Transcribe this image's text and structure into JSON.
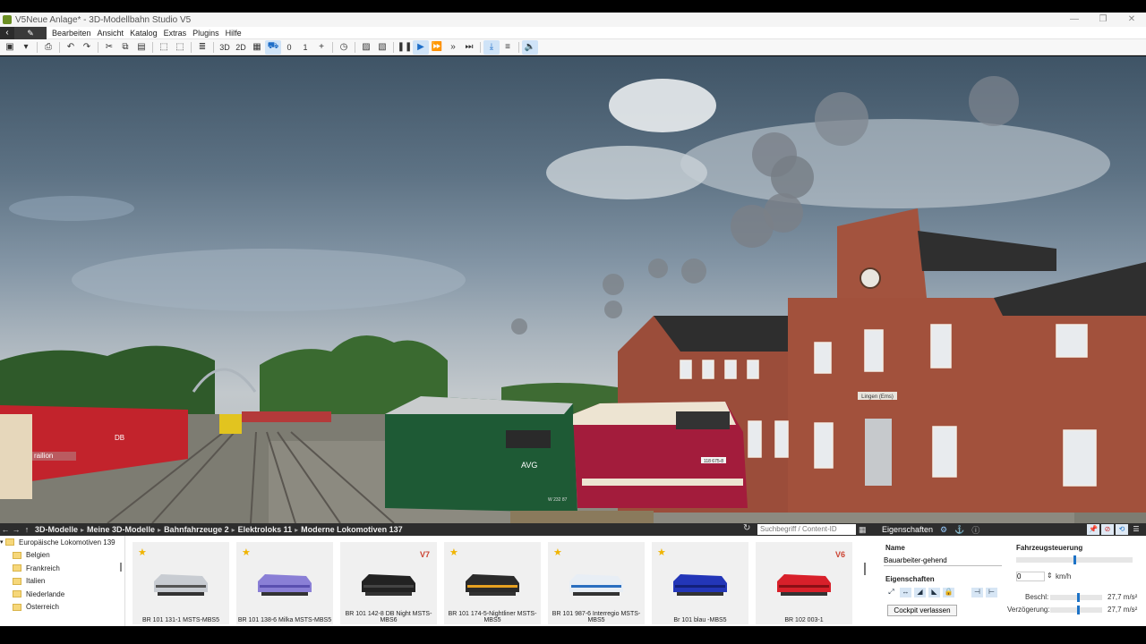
{
  "window": {
    "title": "V5Neue Anlage* - 3D-Modellbahn Studio V5",
    "controls": [
      "—",
      "❐",
      "✕"
    ]
  },
  "menubar": {
    "items": [
      "Bearbeiten",
      "Ansicht",
      "Katalog",
      "Extras",
      "Plugins",
      "Hilfe"
    ]
  },
  "toolbar": {
    "view_3d": "3D",
    "view_2d": "2D",
    "counter_a": "0",
    "counter_b": "1"
  },
  "scene": {
    "station_sign": "Lingen (Ems)",
    "loco_green_label": "AVG",
    "loco_right_number": "118 675-8",
    "loco_green_number": "W 232 87",
    "wagon_brand": "railion",
    "wagon_logo": "DB"
  },
  "browser": {
    "breadcrumbs": [
      "3D-Modelle",
      "Meine 3D-Modelle",
      "Bahnfahrzeuge 2",
      "Elektroloks 11",
      "Moderne Lokomotiven 137"
    ],
    "search_placeholder": "Suchbegriff / Content-ID",
    "tree": [
      "Europäische Lokomotiven 139",
      "Belgien",
      "Frankreich",
      "Italien",
      "Niederlande",
      "Österreich"
    ],
    "cards": [
      {
        "label": "BR 101 131-1 MSTS-MBS5",
        "star": true,
        "badge": "",
        "color": "#c8ccd2",
        "stripe": "#555"
      },
      {
        "label": "BR 101 138-6 Milka MSTS-MBS5",
        "star": true,
        "badge": "",
        "color": "#8a7fd6",
        "stripe": "#5a4fb0"
      },
      {
        "label": "BR 101 142-8 DB Night MSTS-MBS6",
        "star": false,
        "badge": "V7",
        "color": "#222",
        "stripe": "#444"
      },
      {
        "label": "BR 101 174-5-Nightliner MSTS-MBS5",
        "star": true,
        "badge": "",
        "color": "#2a2a2a",
        "stripe": "#e6a020"
      },
      {
        "label": "BR 101 987-6 Interregio MSTS-MBS5",
        "star": true,
        "badge": "",
        "color": "#e8eef5",
        "stripe": "#2a6fc0"
      },
      {
        "label": "Br 101 blau -MBS5",
        "star": true,
        "badge": "",
        "color": "#2336b8",
        "stripe": "#13207a"
      },
      {
        "label": "BR 102 003-1",
        "star": false,
        "badge": "V6",
        "color": "#d8202a",
        "stripe": "#8a0f15"
      }
    ]
  },
  "properties": {
    "header": "Eigenschaften",
    "name_heading": "Name",
    "name_value": "Bauarbeiter-gehend",
    "props_heading": "Eigenschaften",
    "cockpit_button": "Cockpit verlassen",
    "control_heading": "Fahrzeugsteuerung",
    "speed_value": "0",
    "speed_unit": "km/h",
    "accel_label": "Beschl:",
    "accel_value": "27,7 m/s²",
    "decel_label": "Verzögerung:",
    "decel_value": "27,7 m/s²"
  },
  "colors": {
    "accent": "#1e73c6",
    "panel_dark": "#2d2d2d",
    "star": "#f0b400"
  }
}
